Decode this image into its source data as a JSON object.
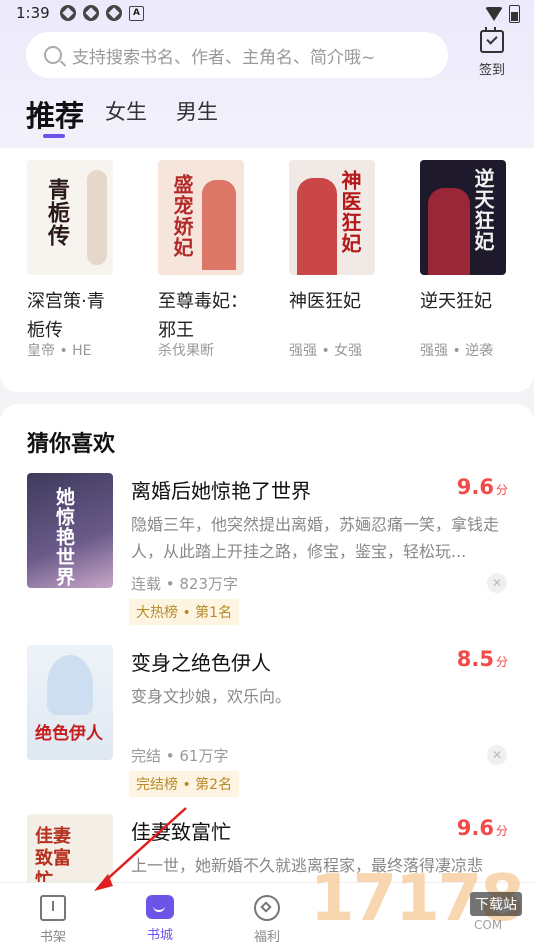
{
  "status_bar": {
    "time": "1:39",
    "notification_icons": [
      "app-icon",
      "app-icon",
      "app-icon",
      "a-icon"
    ],
    "badge_a": "A"
  },
  "search": {
    "placeholder": "支持搜索书名、作者、主角名、简介哦~"
  },
  "checkin": {
    "label": "签到"
  },
  "tabs": [
    {
      "label": "推荐",
      "active": true
    },
    {
      "label": "女生",
      "active": false
    },
    {
      "label": "男生",
      "active": false
    }
  ],
  "recommend": [
    {
      "title": "深宫策·青栀传",
      "tags": "皇帝 • HE",
      "cover_text": "青栀传",
      "cover_bg": "#f7f3ef",
      "cover_color": "#2a1a1a"
    },
    {
      "title": "至尊毒妃：邪王",
      "tags": "杀伐果断",
      "cover_text": "盛宠娇妃",
      "cover_bg": "#f6e5da",
      "cover_color": "#b32a2a"
    },
    {
      "title": "神医狂妃",
      "tags": "强强 • 女强",
      "cover_text": "神医狂妃",
      "cover_bg": "#f1e9e6",
      "cover_color": "#b51818"
    },
    {
      "title": "逆天狂妃",
      "tags": "强强 • 逆袭",
      "cover_text": "逆天狂妃",
      "cover_bg": "#1e1a2c",
      "cover_color": "#f2f2f2"
    }
  ],
  "guess": {
    "title": "猜你喜欢",
    "books": [
      {
        "title": "离婚后她惊艳了世界",
        "score": "9.6",
        "score_unit": "分",
        "desc": "隐婚三年，他突然提出离婚，苏婳忍痛一笑，拿钱走人，从此踏上开挂之路，修宝，鉴宝，轻松玩...",
        "meta": "连载 • 823万字",
        "badge": "大热榜 • 第1名",
        "cover_text": "她惊艳世界",
        "cover_bg": "#3f3a5c",
        "cover_color": "#ffffff"
      },
      {
        "title": "变身之绝色伊人",
        "score": "8.5",
        "score_unit": "分",
        "desc": "变身文抄娘，欢乐向。",
        "meta": "完结 • 61万字",
        "badge": "完结榜 • 第2名",
        "cover_text": "绝色伊人",
        "cover_bg": "#eef3f8",
        "cover_color": "#c61c1c"
      },
      {
        "title": "佳妻致富忙",
        "score": "9.6",
        "score_unit": "分",
        "desc": "上一世，她新婚不久就逃离程家，最终落得凄凉悲",
        "meta": "",
        "badge": "",
        "cover_text": "佳妻致富忙",
        "cover_bg": "#f3efe6",
        "cover_color": "#b5301f"
      }
    ]
  },
  "close_symbol": "✕",
  "nav": [
    {
      "label": "书架",
      "icon": "bookshelf-icon",
      "active": false
    },
    {
      "label": "书城",
      "icon": "bookstore-icon",
      "active": true
    },
    {
      "label": "福利",
      "icon": "welfare-icon",
      "active": false
    }
  ],
  "watermark": {
    "text": "17178",
    "badge": "下载站",
    "sub": "COM"
  },
  "colors": {
    "accent": "#6a55e8",
    "score": "#f24949",
    "badge_text": "#b78a2a",
    "badge_bg": "#fdf4e1"
  }
}
